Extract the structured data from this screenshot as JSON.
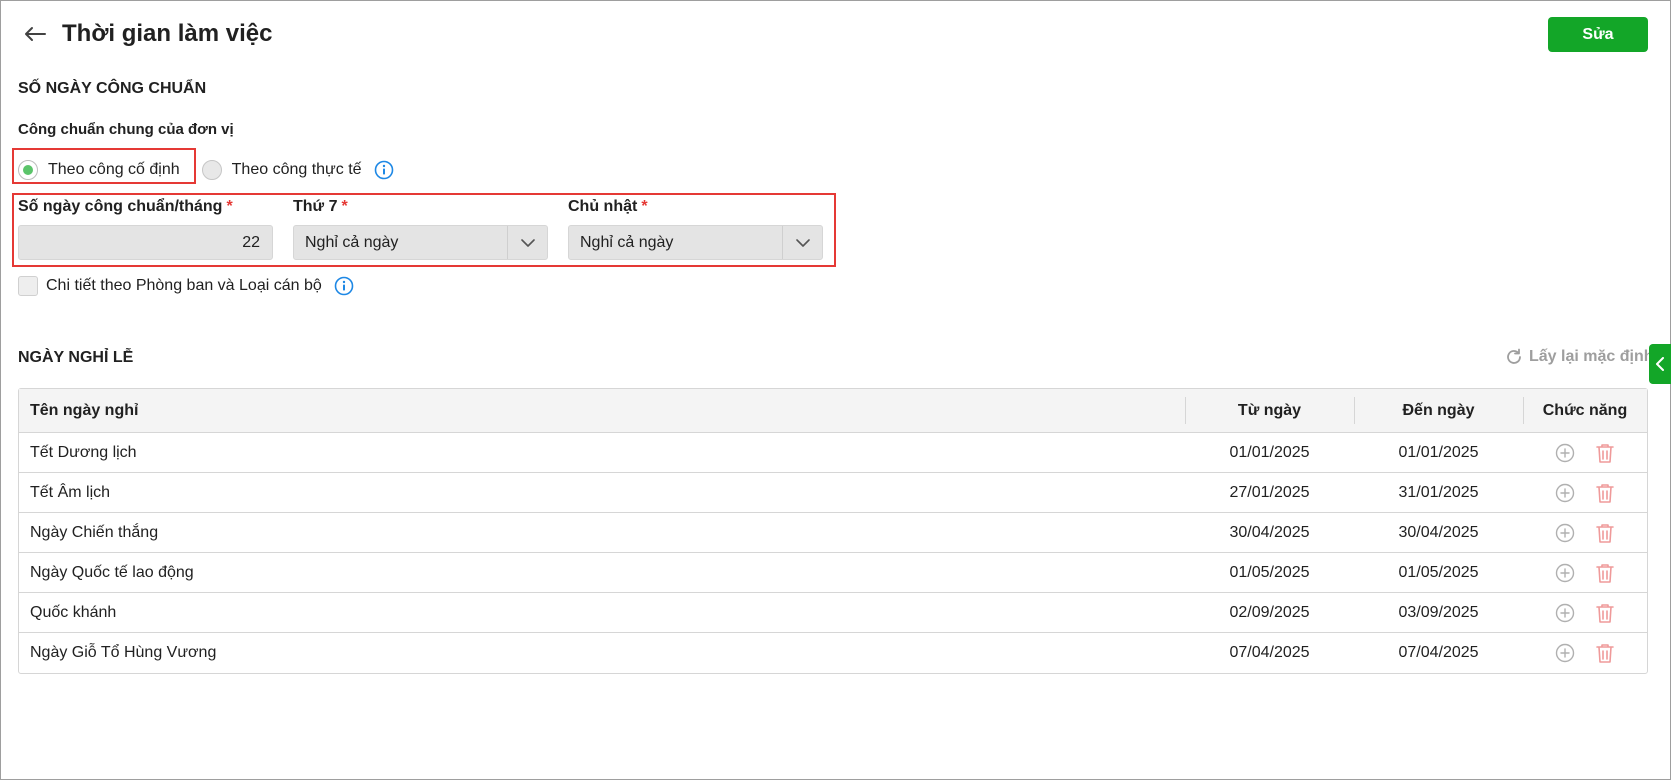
{
  "header": {
    "title": "Thời gian làm việc",
    "edit_label": "Sửa"
  },
  "standard_days": {
    "section_title": "SỐ NGÀY CÔNG CHUẨN",
    "group_title": "Công chuẩn chung của đơn vị",
    "options": [
      {
        "label": "Theo công cố định",
        "checked": true
      },
      {
        "label": "Theo công thực tế",
        "checked": false
      }
    ],
    "fields": {
      "days_per_month": {
        "label": "Số ngày công chuẩn/tháng",
        "required_mark": "*",
        "value": "22"
      },
      "saturday": {
        "label": "Thứ 7",
        "required_mark": "*",
        "value": "Nghỉ cả ngày"
      },
      "sunday": {
        "label": "Chủ nhật",
        "required_mark": "*",
        "value": "Nghỉ cả ngày"
      }
    },
    "detail_checkbox_label": "Chi tiết theo Phòng ban và Loại cán bộ"
  },
  "holidays": {
    "section_title": "NGÀY NGHỈ LỄ",
    "reset_label": "Lấy lại mặc định",
    "columns": [
      "Tên ngày nghỉ",
      "Từ ngày",
      "Đến ngày",
      "Chức năng"
    ],
    "rows": [
      {
        "name": "Tết Dương lịch",
        "from": "01/01/2025",
        "to": "01/01/2025"
      },
      {
        "name": "Tết Âm lịch",
        "from": "27/01/2025",
        "to": "31/01/2025"
      },
      {
        "name": "Ngày Chiến thắng",
        "from": "30/04/2025",
        "to": "30/04/2025"
      },
      {
        "name": "Ngày Quốc tế lao động",
        "from": "01/05/2025",
        "to": "01/05/2025"
      },
      {
        "name": "Quốc khánh",
        "from": "02/09/2025",
        "to": "03/09/2025"
      },
      {
        "name": "Ngày Giỗ Tổ Hùng Vương",
        "from": "07/04/2025",
        "to": "07/04/2025"
      }
    ]
  },
  "colors": {
    "primary": "#13a628",
    "highlight": "#e53935",
    "info": "#1e88e5",
    "delete": "#ef9a9a"
  }
}
